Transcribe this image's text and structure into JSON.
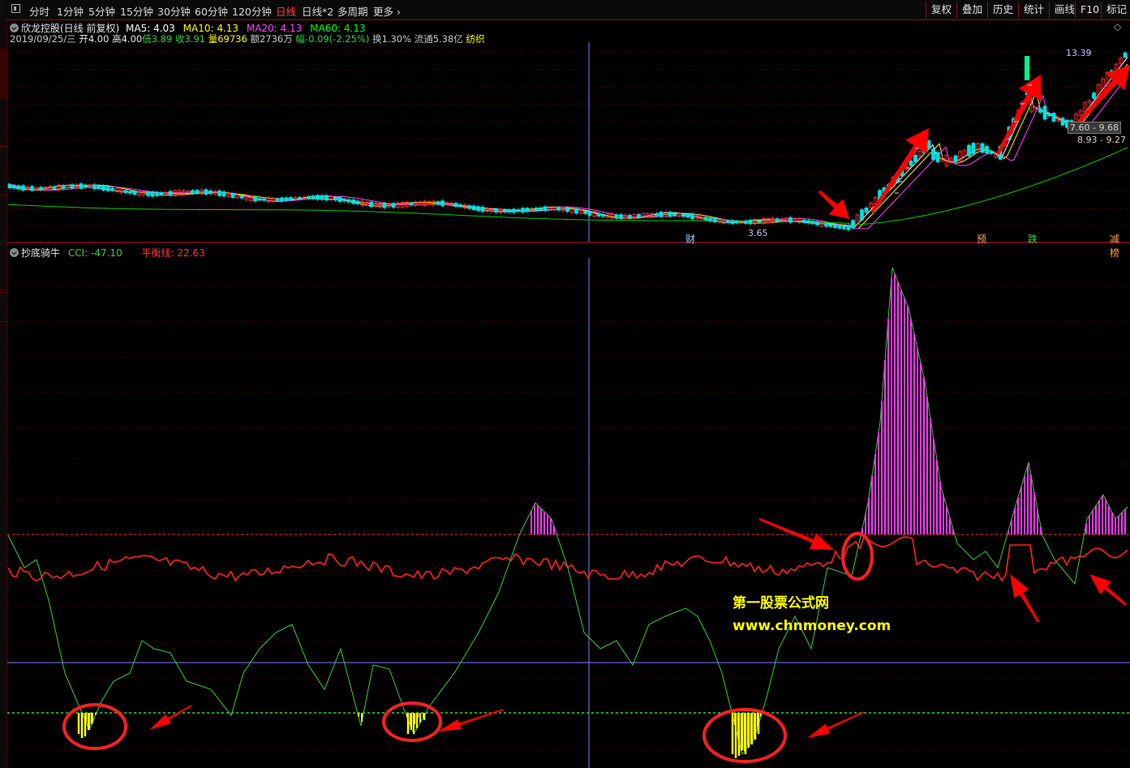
{
  "toolbar": {
    "periods": [
      "分时",
      "1分钟",
      "5分钟",
      "15分钟",
      "30分钟",
      "60分钟",
      "120分钟",
      "日线",
      "日线*2",
      "多周期",
      "更多"
    ],
    "active_period": "日线",
    "right_buttons": [
      "复权",
      "叠加",
      "历史",
      "统计",
      "画线",
      "F10",
      "标记"
    ]
  },
  "main_chart": {
    "stock_name": "欣龙控股(日线 前复权)",
    "ma5": {
      "label": "MA5:",
      "value": "4.03",
      "color": "#ffffff"
    },
    "ma10": {
      "label": "MA10:",
      "value": "4.13",
      "color": "#ffff00"
    },
    "ma20": {
      "label": "MA20:",
      "value": "4.13",
      "color": "#ff44ff"
    },
    "ma60": {
      "label": "MA60:",
      "value": "4.13",
      "color": "#00ff00"
    },
    "info": {
      "date": "2019/09/25/三",
      "open": "开4.00",
      "high": "高4.00",
      "low": "低3.89",
      "close": "收3.91",
      "volume": "量69736",
      "amount": "额2736万",
      "change": "幅-0.09(-2.25%)",
      "turnover": "换1.30%",
      "float_cap": "流通5.38亿",
      "industry": "纺织"
    },
    "price_high_label": "13.39",
    "price_low_label": "3.65",
    "price_box_1": "7.60 - 9.68",
    "price_box_2": "8.93 - 9.27",
    "markers": {
      "cai": "财",
      "yu": "预",
      "die": "跌",
      "jian": "减榜"
    }
  },
  "indicator": {
    "name": "抄底骑牛",
    "cci_label": "CCI:",
    "cci_value": "-47.10",
    "balance_label": "平衡线:",
    "balance_value": "22.63"
  },
  "watermark": {
    "line1": "第一股票公式网",
    "line2": "www.chnmoney.com"
  },
  "colors": {
    "up": "#ff3030",
    "down": "#00e0e0",
    "cci": "#3ccc3c",
    "balance": "#ff2020",
    "magenta_bars": "#ff30ff",
    "yellow_bars": "#ffff00",
    "grid": "#6b0000",
    "crosshair": "#8080ff",
    "accent": "#ff2020"
  }
}
